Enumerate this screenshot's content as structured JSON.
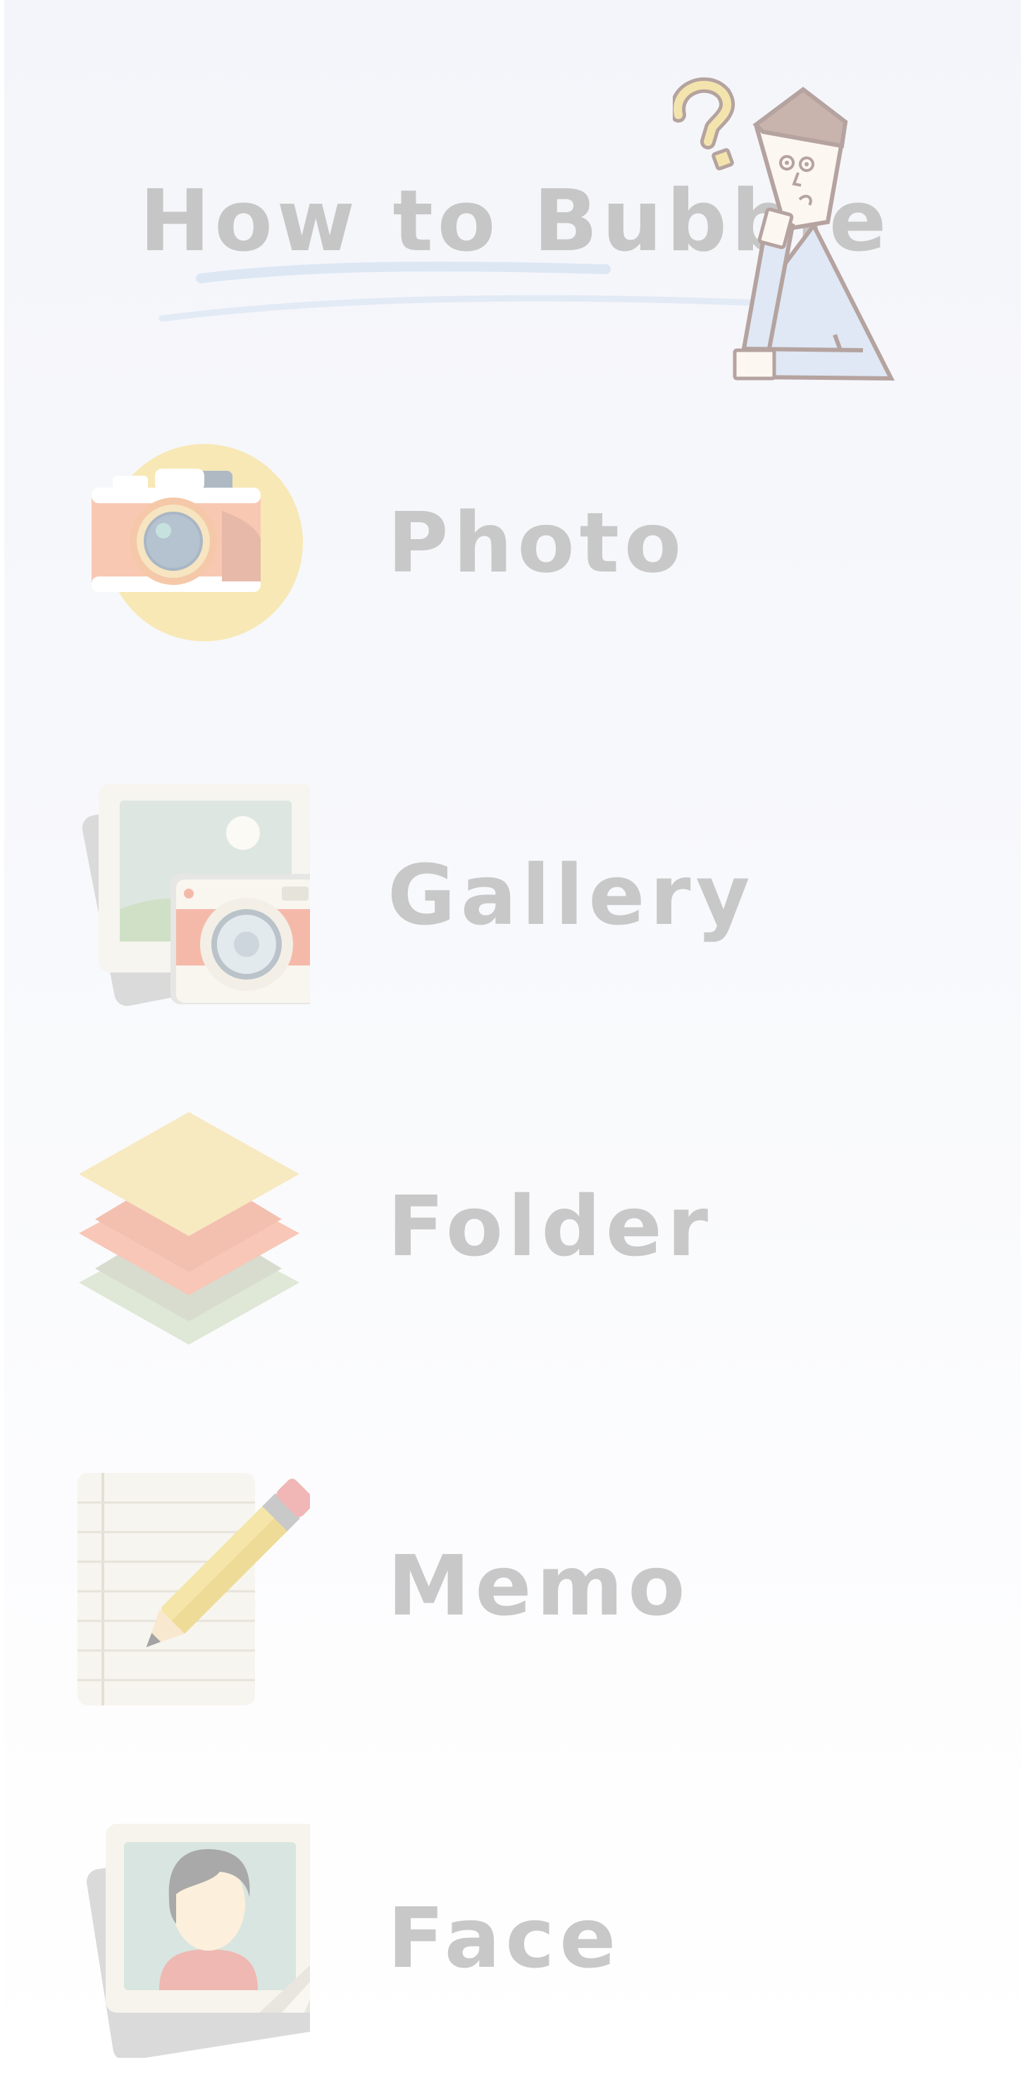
{
  "header": {
    "title": "How to Bubble",
    "illustration": "thinking-person-question-mark"
  },
  "menu": {
    "items": [
      {
        "label": "Photo",
        "icon": "camera-icon"
      },
      {
        "label": "Gallery",
        "icon": "gallery-icon"
      },
      {
        "label": "Folder",
        "icon": "layers-icon"
      },
      {
        "label": "Memo",
        "icon": "memo-pencil-icon"
      },
      {
        "label": "Face",
        "icon": "face-portrait-icon"
      }
    ]
  },
  "colors": {
    "background": "#f6f7fb",
    "label_text": "#c8c8c8",
    "accent_yellow": "#f7e9b8",
    "accent_pink": "#f8c4b0",
    "accent_green": "#dde5d4",
    "accent_blue": "#dfe8f4"
  }
}
